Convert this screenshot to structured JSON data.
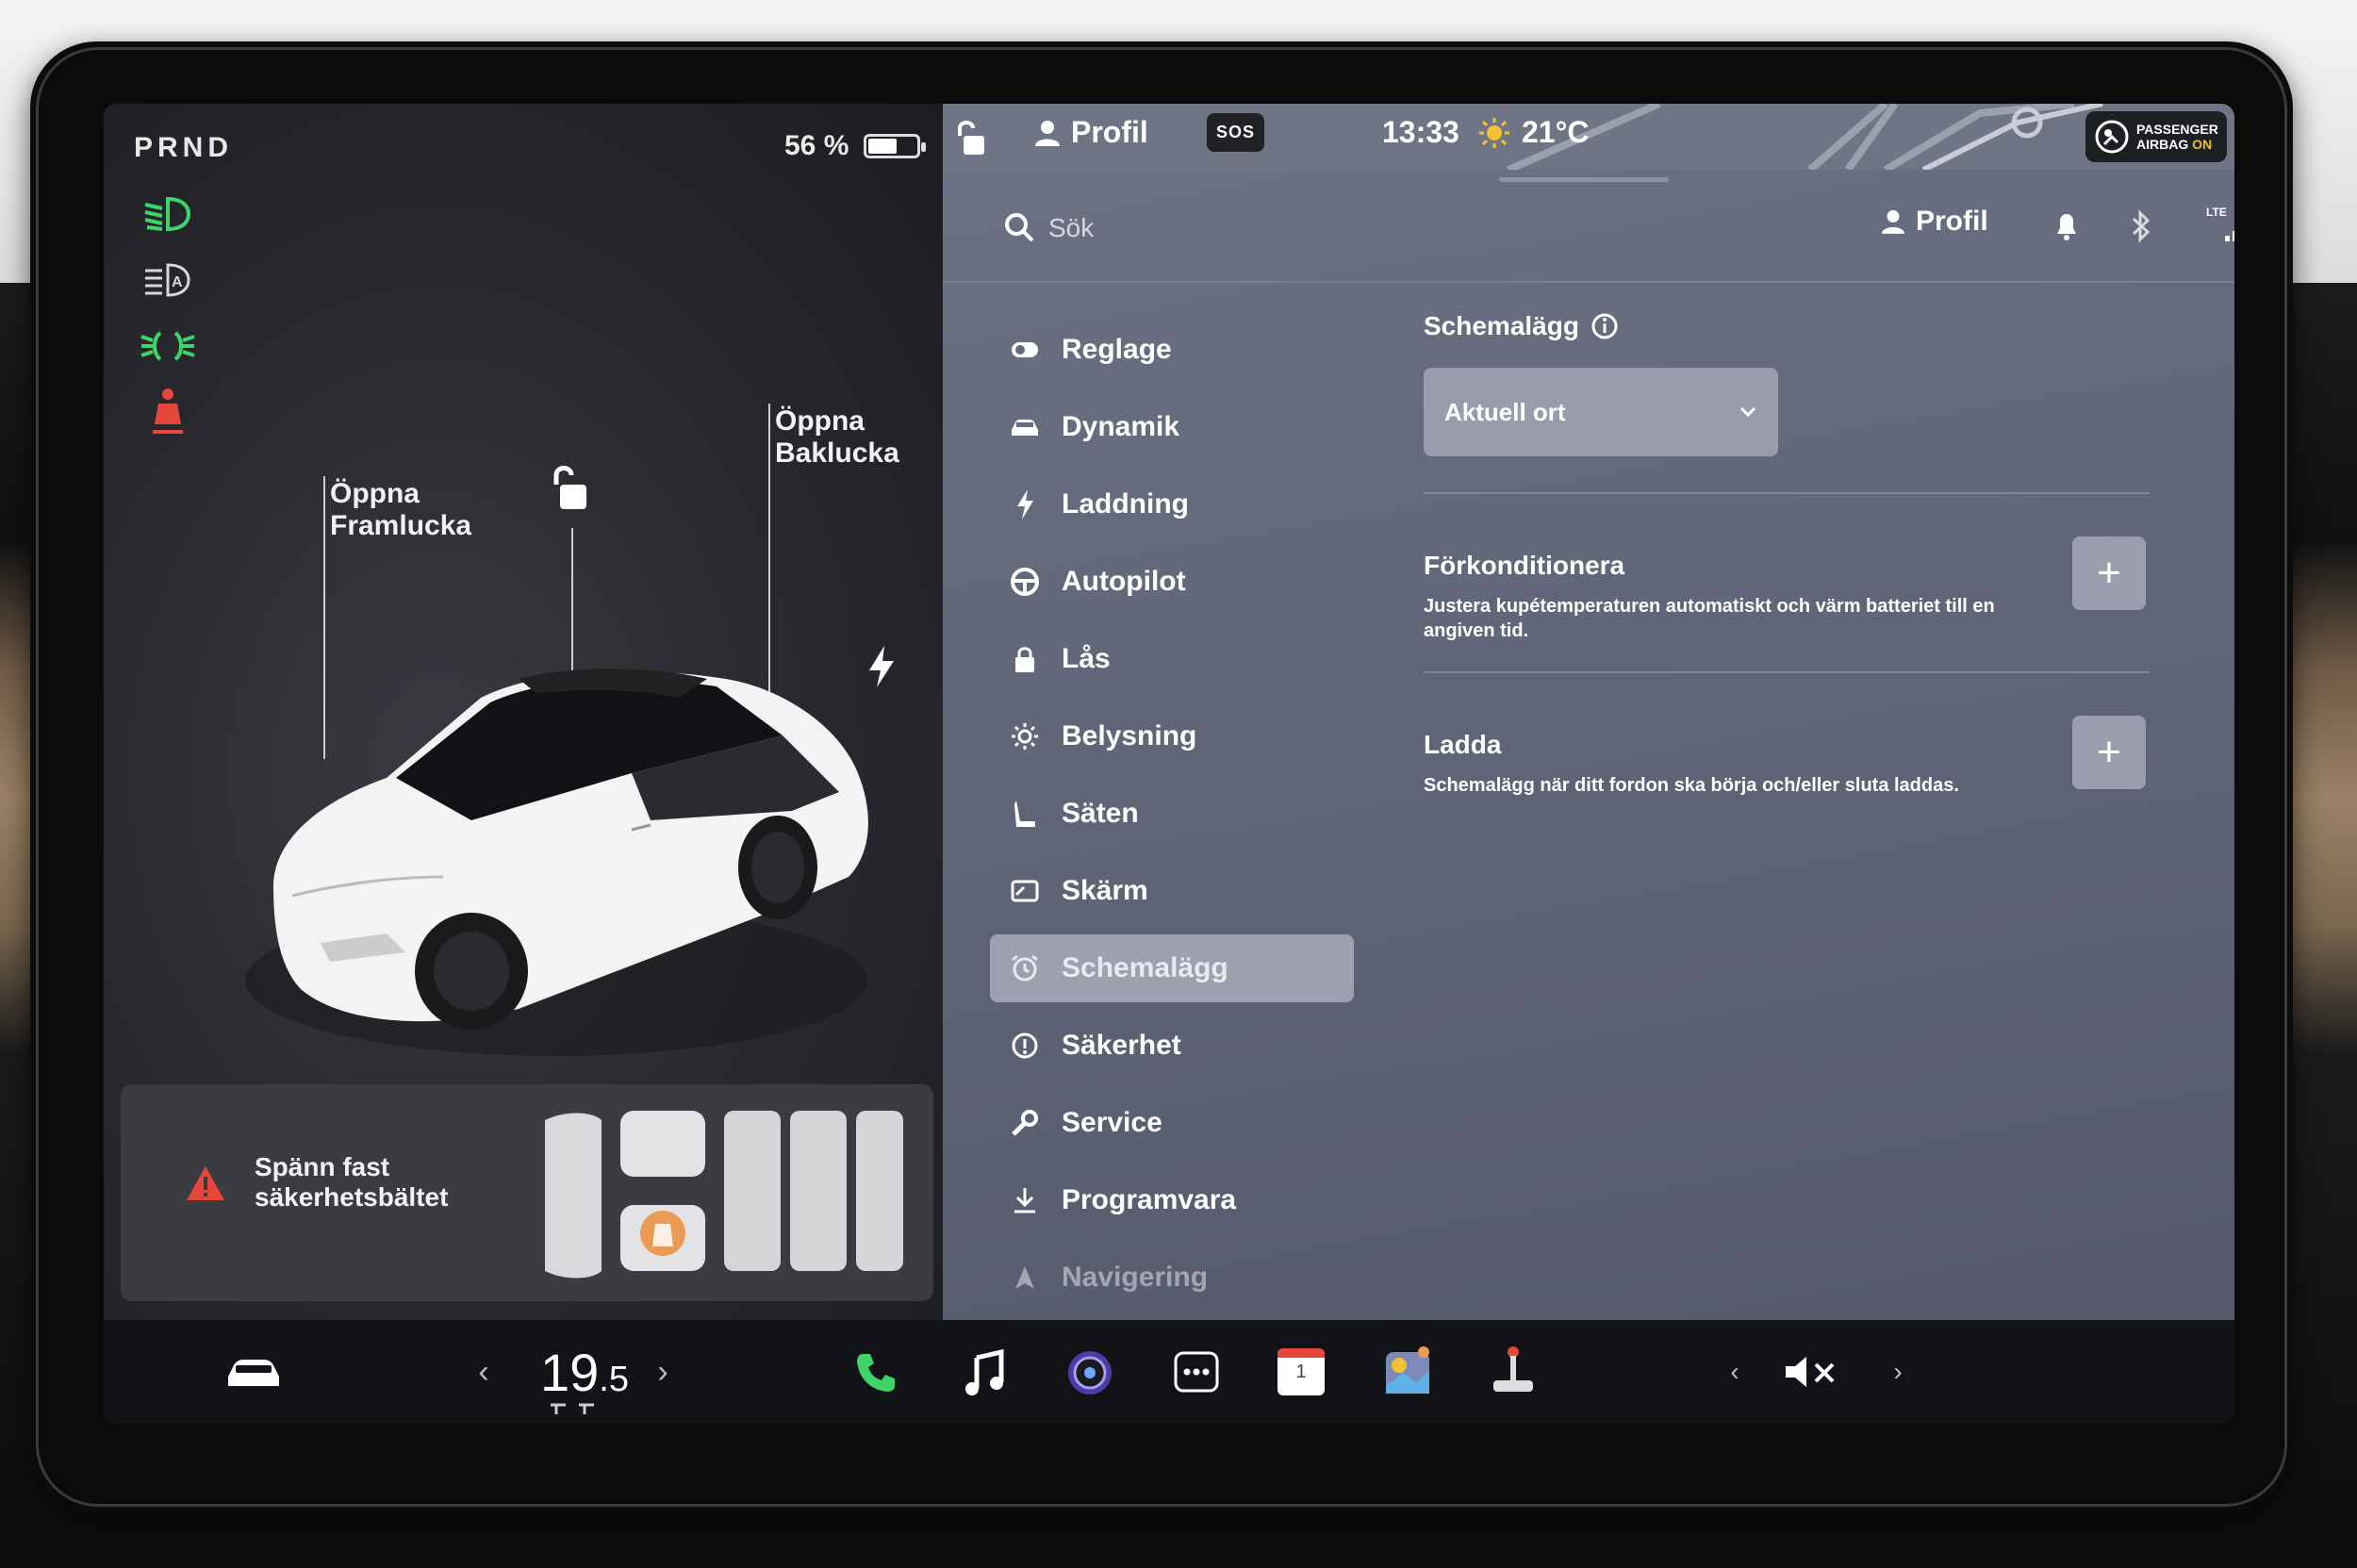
{
  "gear": "PRND",
  "battery": {
    "percent_text": "56 %",
    "level": 0.56
  },
  "telltales": [
    "low-beam-icon",
    "auto-high-beam-icon",
    "parking-lights-icon",
    "seatbelt-warning-icon"
  ],
  "car": {
    "frunk_label": "Öppna\nFramlucka",
    "trunk_label": "Öppna\nBaklucka"
  },
  "seat_alert": {
    "text": "Spänn fast\nsäkerhetsbältet"
  },
  "status_bar": {
    "profile_label": "Profil",
    "sos_label": "SOS",
    "time": "13:33",
    "temperature": "21°C",
    "airbag_line1": "PASSENGER",
    "airbag_line2": "AIRBAG",
    "airbag_state": "ON"
  },
  "search": {
    "placeholder": "Sök"
  },
  "header_right": {
    "profile_label": "Profil",
    "lte": "LTE"
  },
  "menu": [
    {
      "label": "Reglage",
      "icon": "toggle-icon"
    },
    {
      "label": "Dynamik",
      "icon": "car-icon"
    },
    {
      "label": "Laddning",
      "icon": "bolt-icon"
    },
    {
      "label": "Autopilot",
      "icon": "steering-wheel-icon"
    },
    {
      "label": "Lås",
      "icon": "lock-icon"
    },
    {
      "label": "Belysning",
      "icon": "light-icon"
    },
    {
      "label": "Säten",
      "icon": "seat-icon"
    },
    {
      "label": "Skärm",
      "icon": "display-icon"
    },
    {
      "label": "Schemalägg",
      "icon": "alarm-clock-icon",
      "active": true
    },
    {
      "label": "Säkerhet",
      "icon": "info-circle-icon"
    },
    {
      "label": "Service",
      "icon": "wrench-icon"
    },
    {
      "label": "Programvara",
      "icon": "download-icon"
    },
    {
      "label": "Navigering",
      "icon": "navigation-icon"
    }
  ],
  "content": {
    "title": "Schemalägg",
    "location_select": "Aktuell ort",
    "precondition": {
      "title": "Förkonditionera",
      "description": "Justera kupétemperaturen automatiskt och värm batteriet till en angiven tid."
    },
    "charge": {
      "title": "Ladda",
      "description": "Schemalägg när ditt fordon ska börja och/eller sluta laddas."
    }
  },
  "taskbar": {
    "temp_whole": "19",
    "temp_decimal": ".5",
    "calendar_day": "1",
    "apps": [
      "phone-icon",
      "music-icon",
      "camera-icon",
      "more-icon",
      "calendar-icon",
      "toybox-icon",
      "joystick-icon"
    ]
  },
  "colors": {
    "accent_green": "#3fd46a",
    "warning_red": "#e6473b",
    "seat_orange": "#e99a55"
  }
}
